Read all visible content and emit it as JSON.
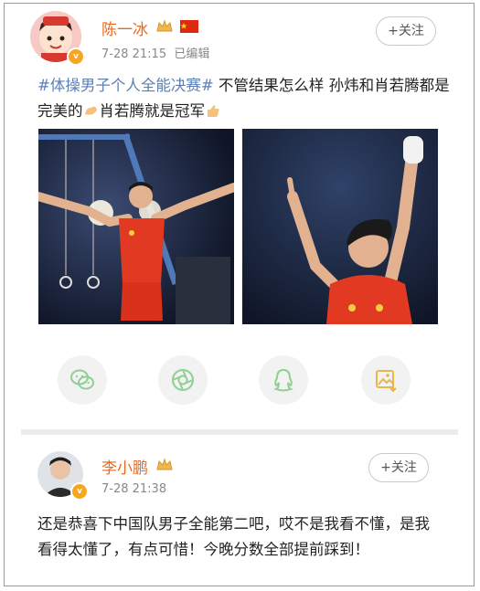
{
  "post1": {
    "username": "陈一冰",
    "time": "7-28 21:15",
    "edited": "已编辑",
    "follow_label": "+关注",
    "topic": "#体操男子个人全能决赛#",
    "text_part1": " 不管结果怎么样 孙炜和肖若腾都是完美的",
    "text_part2": "肖若腾就是冠军"
  },
  "share": {
    "icons": [
      "wechat-icon",
      "moments-icon",
      "qq-icon",
      "save-image-icon"
    ]
  },
  "post2": {
    "username": "李小鹏",
    "time": "7-28 21:38",
    "follow_label": "+关注",
    "text": "还是恭喜下中国队男子全能第二吧，哎不是我看不懂，是我看得太懂了，有点可惜！今晚分数全部提前踩到！"
  },
  "colors": {
    "name": "#e86a1e",
    "topic": "#5b7fb5",
    "share_icon": "#8fcf93",
    "share_icon_yellow": "#e8b64a"
  }
}
